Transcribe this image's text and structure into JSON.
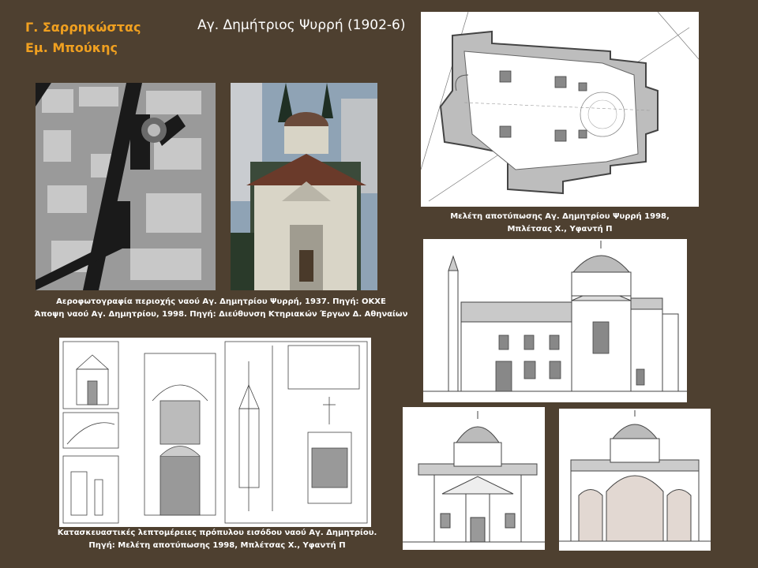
{
  "authors": [
    "Γ. Σαρρηκώστας",
    "Εμ. Μπούκης"
  ],
  "title": "Αγ. Δημήτριος Ψυρρή (1902-6)",
  "captions": {
    "photos": [
      "Αεροφωτογραφία περιοχής ναού Αγ. Δημητρίου Ψυρρή, 1937. Πηγή: ΟΚΧΕ",
      "Άποψη ναού Αγ. Δημητρίου, 1998. Πηγή: Διεύθυνση Κτηριακών Έργων Δ. Αθηναίων"
    ],
    "plan": [
      "Μελέτη αποτύπωσης Αγ. Δημητρίου Ψυρρή 1998,",
      "Μπλέτσας Χ., Υφαντή Π"
    ],
    "details": [
      "Κατασκευαστικές λεπτομέρειες πρόπυλου εισόδου ναού Αγ. Δημητρίου.",
      "Πηγή: Μελέτη αποτύπωσης 1998, Μπλέτσας Χ., Υφαντή Π"
    ]
  },
  "colors": {
    "background": "#4e4030",
    "author": "#f0a020",
    "text": "#ffffff",
    "drawing": "#555555"
  }
}
